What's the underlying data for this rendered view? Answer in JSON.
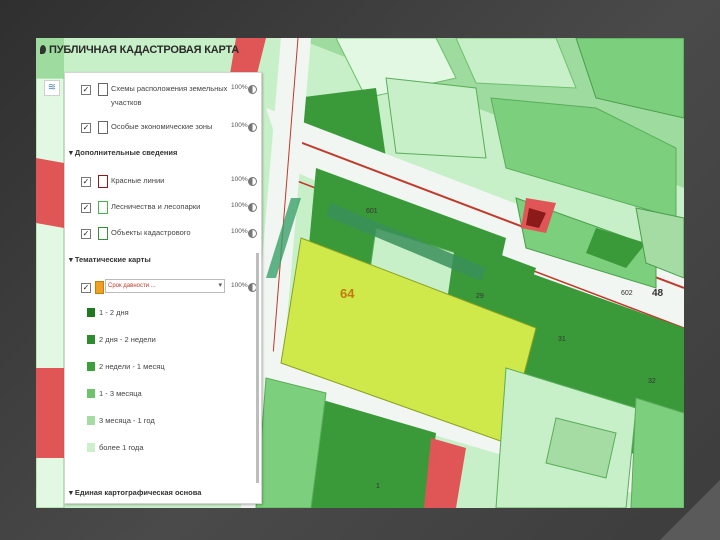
{
  "app": {
    "title": "ПУБЛИЧНАЯ КАДАСТРОВАЯ КАРТА"
  },
  "layers_panel": {
    "items_top": [
      {
        "label": "Схемы расположения земельных участков",
        "line1": "Схемы расположения земельных",
        "line2": "участков",
        "percent": "100%",
        "checked": true
      },
      {
        "label": "Особые экономические зоны",
        "percent": "100%",
        "checked": true
      }
    ],
    "section_additional": "▾ Дополнительные сведения",
    "items_additional": [
      {
        "label": "Красные линии",
        "percent": "100%",
        "checked": true,
        "swatch": "#8b1a1a"
      },
      {
        "label": "Лесничества и лесопарки",
        "percent": "100%",
        "checked": true,
        "swatch": "#4caf50"
      },
      {
        "label": "Объекты кадастрового",
        "percent": "100%",
        "checked": true,
        "swatch": "#3b8f3b"
      }
    ],
    "section_thematic": "▾ Тематические карты",
    "thematic_select": {
      "value": "Срок давности ...",
      "percent": "100%",
      "checked": true
    },
    "legend": [
      {
        "label": "1 - 2 дня",
        "color": "#1e7a1e"
      },
      {
        "label": "2 дня - 2 недели",
        "color": "#2e8b2e"
      },
      {
        "label": "2 недели - 1 месяц",
        "color": "#3aa03a"
      },
      {
        "label": "1 - 3 месяца",
        "color": "#6cc36c"
      },
      {
        "label": "3 месяца - 1 год",
        "color": "#a4dca4"
      },
      {
        "label": "более 1 года",
        "color": "#ccefcc"
      }
    ],
    "section_base": "▾ Единая картографическая основа"
  },
  "map": {
    "highlight_number": "64",
    "labels": [
      "48",
      "602",
      "601",
      "02",
      "8",
      "29",
      "31",
      "32",
      "37",
      "1",
      "4",
      "38",
      "49"
    ],
    "colors": {
      "dark": "#3a9a3a",
      "mid": "#7ccf7c",
      "light": "#c8f0c8",
      "pale": "#e2f8e2",
      "red": "#e05555",
      "highlight": "#cfe84a",
      "road": "#c0392b"
    }
  }
}
